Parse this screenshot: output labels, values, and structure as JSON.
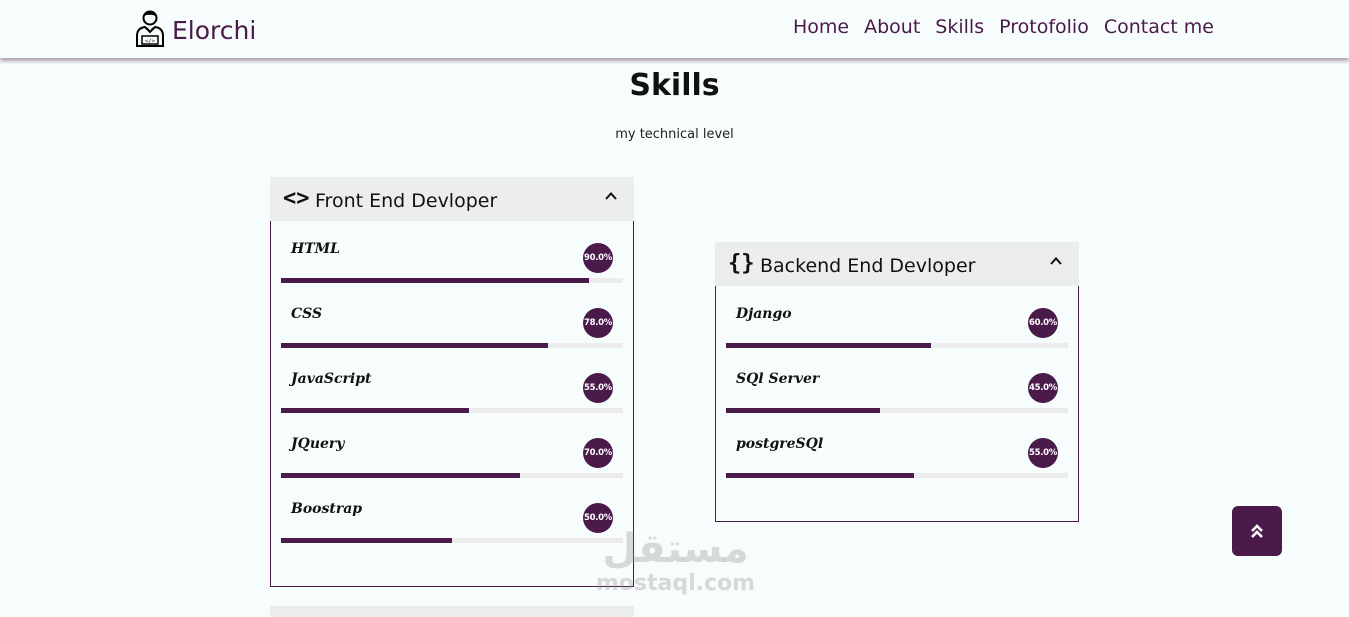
{
  "brand": {
    "name": "Elorchi",
    "icon": "developer-avatar-icon"
  },
  "nav": {
    "links": [
      {
        "label": "Home"
      },
      {
        "label": "About"
      },
      {
        "label": "Skills"
      },
      {
        "label": "Protofolio"
      },
      {
        "label": "Contact me"
      }
    ]
  },
  "section": {
    "title": "Skills",
    "subtitle": "my technical level"
  },
  "frontend": {
    "icon_glyph": "<>",
    "title": "Front End Devloper",
    "skills": [
      {
        "name": "HTML",
        "percent_label": "90.0%",
        "value": 90
      },
      {
        "name": "CSS",
        "percent_label": "78.0%",
        "value": 78
      },
      {
        "name": "JavaScript",
        "percent_label": "55.0%",
        "value": 55
      },
      {
        "name": "JQuery",
        "percent_label": "70.0%",
        "value": 70
      },
      {
        "name": "Boostrap",
        "percent_label": "50.0%",
        "value": 50
      }
    ]
  },
  "backend": {
    "icon_glyph": "{}",
    "title": "Backend End Devloper",
    "skills": [
      {
        "name": "Django",
        "percent_label": "60.0%",
        "value": 60
      },
      {
        "name": "SQl Server",
        "percent_label": "45.0%",
        "value": 45
      },
      {
        "name": "postgreSQl",
        "percent_label": "55.0%",
        "value": 55
      }
    ]
  },
  "watermark": {
    "arabic": "مستقل",
    "latin": "mostaql.com"
  },
  "colors": {
    "accent": "#4a1a4a",
    "background": "#f7fdfd",
    "card_header": "#eceeee",
    "bar_track": "#ececec"
  }
}
